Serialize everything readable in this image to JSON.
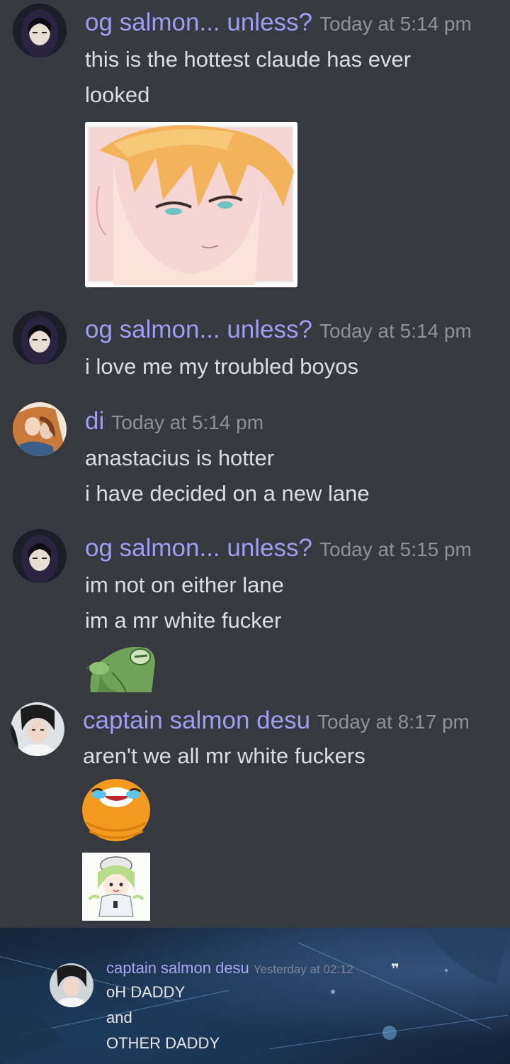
{
  "messages": [
    {
      "author": "og salmon... unless?",
      "time": "Today at 5:14 pm",
      "lines": [
        "this is the hottest claude has ever",
        "looked"
      ],
      "attachment": "anime-boy-image"
    },
    {
      "author": "og salmon... unless?",
      "time": "Today at 5:14 pm",
      "lines": [
        "i love me my troubled boyos"
      ]
    },
    {
      "author": "di",
      "time": "Today at 5:14 pm",
      "lines": [
        "anastacius is hotter",
        "i have decided on a new lane"
      ]
    },
    {
      "author": "og salmon... unless?",
      "time": "Today at 5:15 pm",
      "lines": [
        "im not on either lane",
        "im a mr white fucker"
      ],
      "attachment": "frog-emote"
    },
    {
      "author": "captain salmon desu",
      "time": "Today at 8:17 pm",
      "lines": [
        "aren't we all mr white fuckers"
      ],
      "attachments": [
        "crying-laughing-emote",
        "chibi-sticker"
      ]
    }
  ],
  "quoted_screenshot": {
    "author": "captain salmon desu",
    "time": "Yesterday at 02:12",
    "quote_icon": "❞",
    "lines": [
      "oH DADDY",
      "and",
      "OTHER DADDY"
    ]
  },
  "colors": {
    "background": "#36393f",
    "author": "#a29df0",
    "text": "#dcddde",
    "timestamp": "#8e9297"
  }
}
